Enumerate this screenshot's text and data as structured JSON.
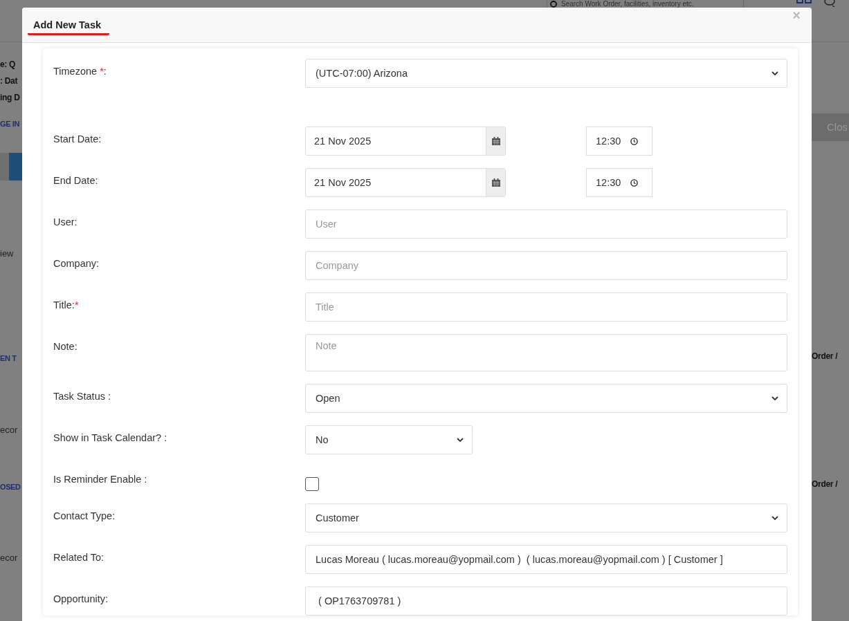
{
  "background": {
    "search": {
      "placeholder": "Search Work Order, facilities, inventory etc."
    },
    "left_fragments": [
      {
        "text": "e: Q",
        "kind": "bold"
      },
      {
        "text": ": Dat",
        "kind": "bold"
      },
      {
        "text": "ing D",
        "kind": "bold"
      },
      {
        "text": "GE IN",
        "kind": "heading"
      },
      {
        "text": "iew",
        "kind": "plain"
      },
      {
        "text": "EN T",
        "kind": "heading"
      },
      {
        "text": "ecor",
        "kind": "plain"
      },
      {
        "text": "OSED",
        "kind": "heading"
      },
      {
        "text": "ecor",
        "kind": "plain"
      }
    ],
    "right_fragments": [
      {
        "text": "Clos",
        "kind": "step"
      },
      {
        "text": "Order /",
        "kind": "bold"
      },
      {
        "text": "Order /",
        "kind": "bold"
      }
    ]
  },
  "dialog": {
    "title": "Add New Task",
    "close": "×",
    "fields": [
      {
        "kind": "select",
        "label": "Timezone",
        "required": "*",
        "after": ":",
        "value": "(UTC-07:00) Arizona"
      },
      {
        "kind": "datetime",
        "label": "Start Date:",
        "date": "21 Nov 2025",
        "time": "12:30"
      },
      {
        "kind": "datetime",
        "label": "End Date:",
        "date": "21 Nov 2025",
        "time": "12:30"
      },
      {
        "kind": "text",
        "label": "User:",
        "placeholder": "User"
      },
      {
        "kind": "text",
        "label": "Company:",
        "placeholder": "Company"
      },
      {
        "kind": "text",
        "label": "Title:",
        "required": "*",
        "placeholder": "Title"
      },
      {
        "kind": "textarea",
        "label": "Note:",
        "placeholder": "Note"
      },
      {
        "kind": "select",
        "label": "Task Status :",
        "value": "Open"
      },
      {
        "kind": "short-select",
        "label": "Show in Task Calendar? :",
        "value": "No"
      },
      {
        "kind": "checkbox",
        "label": "Is Reminder Enable :",
        "checked": false
      },
      {
        "kind": "select",
        "label": "Contact Type:",
        "value": "Customer"
      },
      {
        "kind": "text",
        "label": "Related To:",
        "value": "Lucas Moreau ( lucas.moreau@yopmail.com )  ( lucas.moreau@yopmail.com ) [ Customer ]"
      },
      {
        "kind": "text",
        "label": "Opportunity:",
        "value": " ( OP1763709781 )"
      }
    ]
  }
}
